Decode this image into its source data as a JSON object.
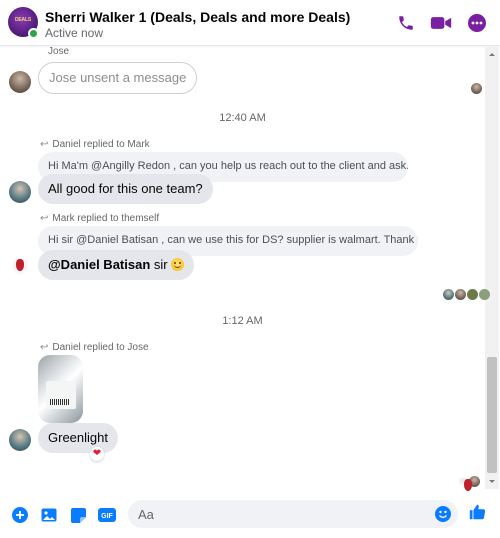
{
  "header": {
    "avatar_text": "DEALS",
    "title": "Sherri Walker 1 (Deals, Deals and more Deals)",
    "status": "Active now",
    "icons": [
      "phone-icon",
      "video-icon",
      "more-icon"
    ],
    "accent_color": "#7b1fa2",
    "online_color": "#31a24c"
  },
  "messages": {
    "first": {
      "sender": "Jose",
      "text": "Jose unsent a message"
    },
    "time1": "12:40 AM",
    "reply1": {
      "label": "Daniel replied to Mark",
      "quoted": "Hi Ma'm @Angilly Redon , can you help us reach out to the client and ask...",
      "text": "All good for this one team?"
    },
    "reply2": {
      "label": "Mark replied to themself",
      "quoted": "Hi sir @Daniel Batisan , can we use this for DS? supplier is walmart. Thank you",
      "mention": "@Daniel Batisan",
      "text_after": " sir"
    },
    "time2": "1:12 AM",
    "reply3": {
      "label": "Daniel replied to Jose",
      "text": "Greenlight",
      "reaction": "❤"
    }
  },
  "composer": {
    "placeholder": "Aa",
    "icons": [
      "add-icon",
      "photo-icon",
      "sticker-icon",
      "gif-icon",
      "emoji-icon",
      "like-icon"
    ],
    "gif_label": "GIF"
  }
}
